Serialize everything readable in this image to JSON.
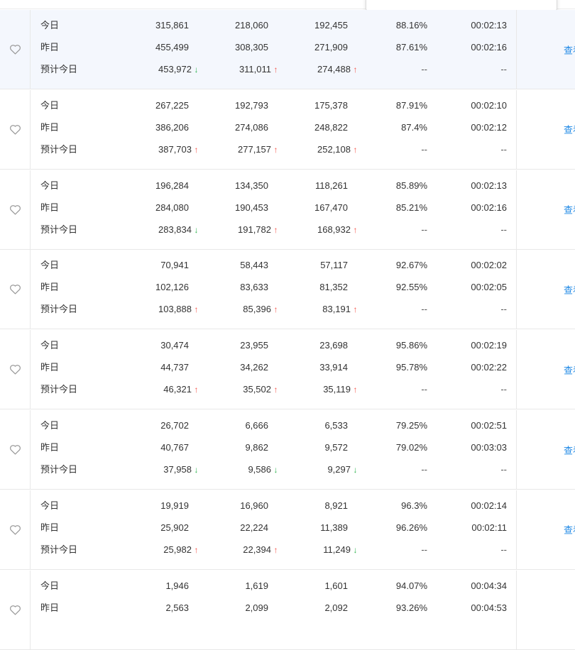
{
  "labels": {
    "today": "今日",
    "yesterday": "昨日",
    "forecast": "预计今日"
  },
  "view_link": "查看",
  "dash": "--",
  "arrows": {
    "up": "↑",
    "down": "↓"
  },
  "colors": {
    "up": "#f5584e",
    "down": "#34b553",
    "link": "#1e88e5",
    "highlight": "#f4f7fd"
  },
  "icons": {
    "favorite": "heart-outline-icon"
  },
  "groups": [
    {
      "today": {
        "v1": "315,861",
        "v2": "218,060",
        "v3": "192,455",
        "rate": "88.16%",
        "time": "00:02:13"
      },
      "yesterday": {
        "v1": "455,499",
        "v2": "308,305",
        "v3": "271,909",
        "rate": "87.61%",
        "time": "00:02:16"
      },
      "forecast": {
        "v1": "453,972",
        "t1": "down",
        "v2": "311,011",
        "t2": "up",
        "v3": "274,488",
        "t3": "up"
      }
    },
    {
      "today": {
        "v1": "267,225",
        "v2": "192,793",
        "v3": "175,378",
        "rate": "87.91%",
        "time": "00:02:10"
      },
      "yesterday": {
        "v1": "386,206",
        "v2": "274,086",
        "v3": "248,822",
        "rate": "87.4%",
        "time": "00:02:12"
      },
      "forecast": {
        "v1": "387,703",
        "t1": "up",
        "v2": "277,157",
        "t2": "up",
        "v3": "252,108",
        "t3": "up"
      }
    },
    {
      "today": {
        "v1": "196,284",
        "v2": "134,350",
        "v3": "118,261",
        "rate": "85.89%",
        "time": "00:02:13"
      },
      "yesterday": {
        "v1": "284,080",
        "v2": "190,453",
        "v3": "167,470",
        "rate": "85.21%",
        "time": "00:02:16"
      },
      "forecast": {
        "v1": "283,834",
        "t1": "down",
        "v2": "191,782",
        "t2": "up",
        "v3": "168,932",
        "t3": "up"
      }
    },
    {
      "today": {
        "v1": "70,941",
        "v2": "58,443",
        "v3": "57,117",
        "rate": "92.67%",
        "time": "00:02:02"
      },
      "yesterday": {
        "v1": "102,126",
        "v2": "83,633",
        "v3": "81,352",
        "rate": "92.55%",
        "time": "00:02:05"
      },
      "forecast": {
        "v1": "103,888",
        "t1": "up",
        "v2": "85,396",
        "t2": "up",
        "v3": "83,191",
        "t3": "up"
      }
    },
    {
      "today": {
        "v1": "30,474",
        "v2": "23,955",
        "v3": "23,698",
        "rate": "95.86%",
        "time": "00:02:19"
      },
      "yesterday": {
        "v1": "44,737",
        "v2": "34,262",
        "v3": "33,914",
        "rate": "95.78%",
        "time": "00:02:22"
      },
      "forecast": {
        "v1": "46,321",
        "t1": "up",
        "v2": "35,502",
        "t2": "up",
        "v3": "35,119",
        "t3": "up"
      }
    },
    {
      "today": {
        "v1": "26,702",
        "v2": "6,666",
        "v3": "6,533",
        "rate": "79.25%",
        "time": "00:02:51"
      },
      "yesterday": {
        "v1": "40,767",
        "v2": "9,862",
        "v3": "9,572",
        "rate": "79.02%",
        "time": "00:03:03"
      },
      "forecast": {
        "v1": "37,958",
        "t1": "down",
        "v2": "9,586",
        "t2": "down",
        "v3": "9,297",
        "t3": "down"
      }
    },
    {
      "today": {
        "v1": "19,919",
        "v2": "16,960",
        "v3": "8,921",
        "rate": "96.3%",
        "time": "00:02:14"
      },
      "yesterday": {
        "v1": "25,902",
        "v2": "22,224",
        "v3": "11,389",
        "rate": "96.26%",
        "time": "00:02:11"
      },
      "forecast": {
        "v1": "25,982",
        "t1": "up",
        "v2": "22,394",
        "t2": "up",
        "v3": "11,249",
        "t3": "down"
      }
    },
    {
      "today": {
        "v1": "1,946",
        "v2": "1,619",
        "v3": "1,601",
        "rate": "94.07%",
        "time": "00:04:34"
      },
      "yesterday": {
        "v1": "2,563",
        "v2": "2,099",
        "v3": "2,092",
        "rate": "93.26%",
        "time": "00:04:53"
      }
    }
  ]
}
